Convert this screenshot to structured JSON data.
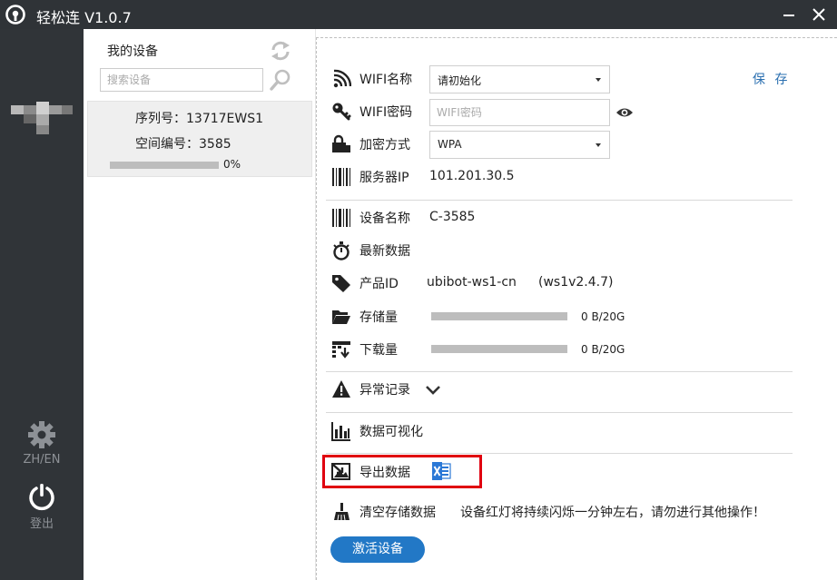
{
  "window": {
    "title": "轻松连 V1.0.7"
  },
  "sidebar": {
    "lang_label": "ZH/EN",
    "logout_label": "登出"
  },
  "devices": {
    "heading": "我的设备",
    "search_placeholder": "搜索设备",
    "items": [
      {
        "serial": "序列号：13717EWS1",
        "space": "空间编号：3585",
        "progress_text": "0%",
        "progress": 0
      }
    ]
  },
  "config": {
    "save_label": "保 存",
    "wifi_name_label": "WIFI名称",
    "wifi_name_value": "请初始化",
    "wifi_pwd_label": "WIFI密码",
    "wifi_pwd_placeholder": "WIFI密码",
    "encrypt_label": "加密方式",
    "encrypt_value": "WPA",
    "server_label": "服务器IP",
    "server_value": "101.201.30.5"
  },
  "device_info": {
    "name_label": "设备名称",
    "name_value": "C-3585",
    "latest_label": "最新数据",
    "product_label": "产品ID",
    "product_value": "ubibot-ws1-cn",
    "product_version": "(ws1v2.4.7)",
    "storage_label": "存储量",
    "storage_value": "0 B/20G",
    "storage_fraction": 0,
    "download_label": "下载量",
    "download_value": "0 B/20G",
    "download_fraction": 0
  },
  "sections": {
    "anomaly_label": "异常记录",
    "visualize_label": "数据可视化",
    "export_label": "导出数据",
    "clear_label": "清空存储数据",
    "clear_warning": "设备红灯将持续闪烁一分钟左右，请勿进行其他操作！",
    "activate_label": "激活设备"
  },
  "colors": {
    "accent": "#2278c6",
    "highlight": "#e0000f",
    "sidebar": "#303438"
  }
}
